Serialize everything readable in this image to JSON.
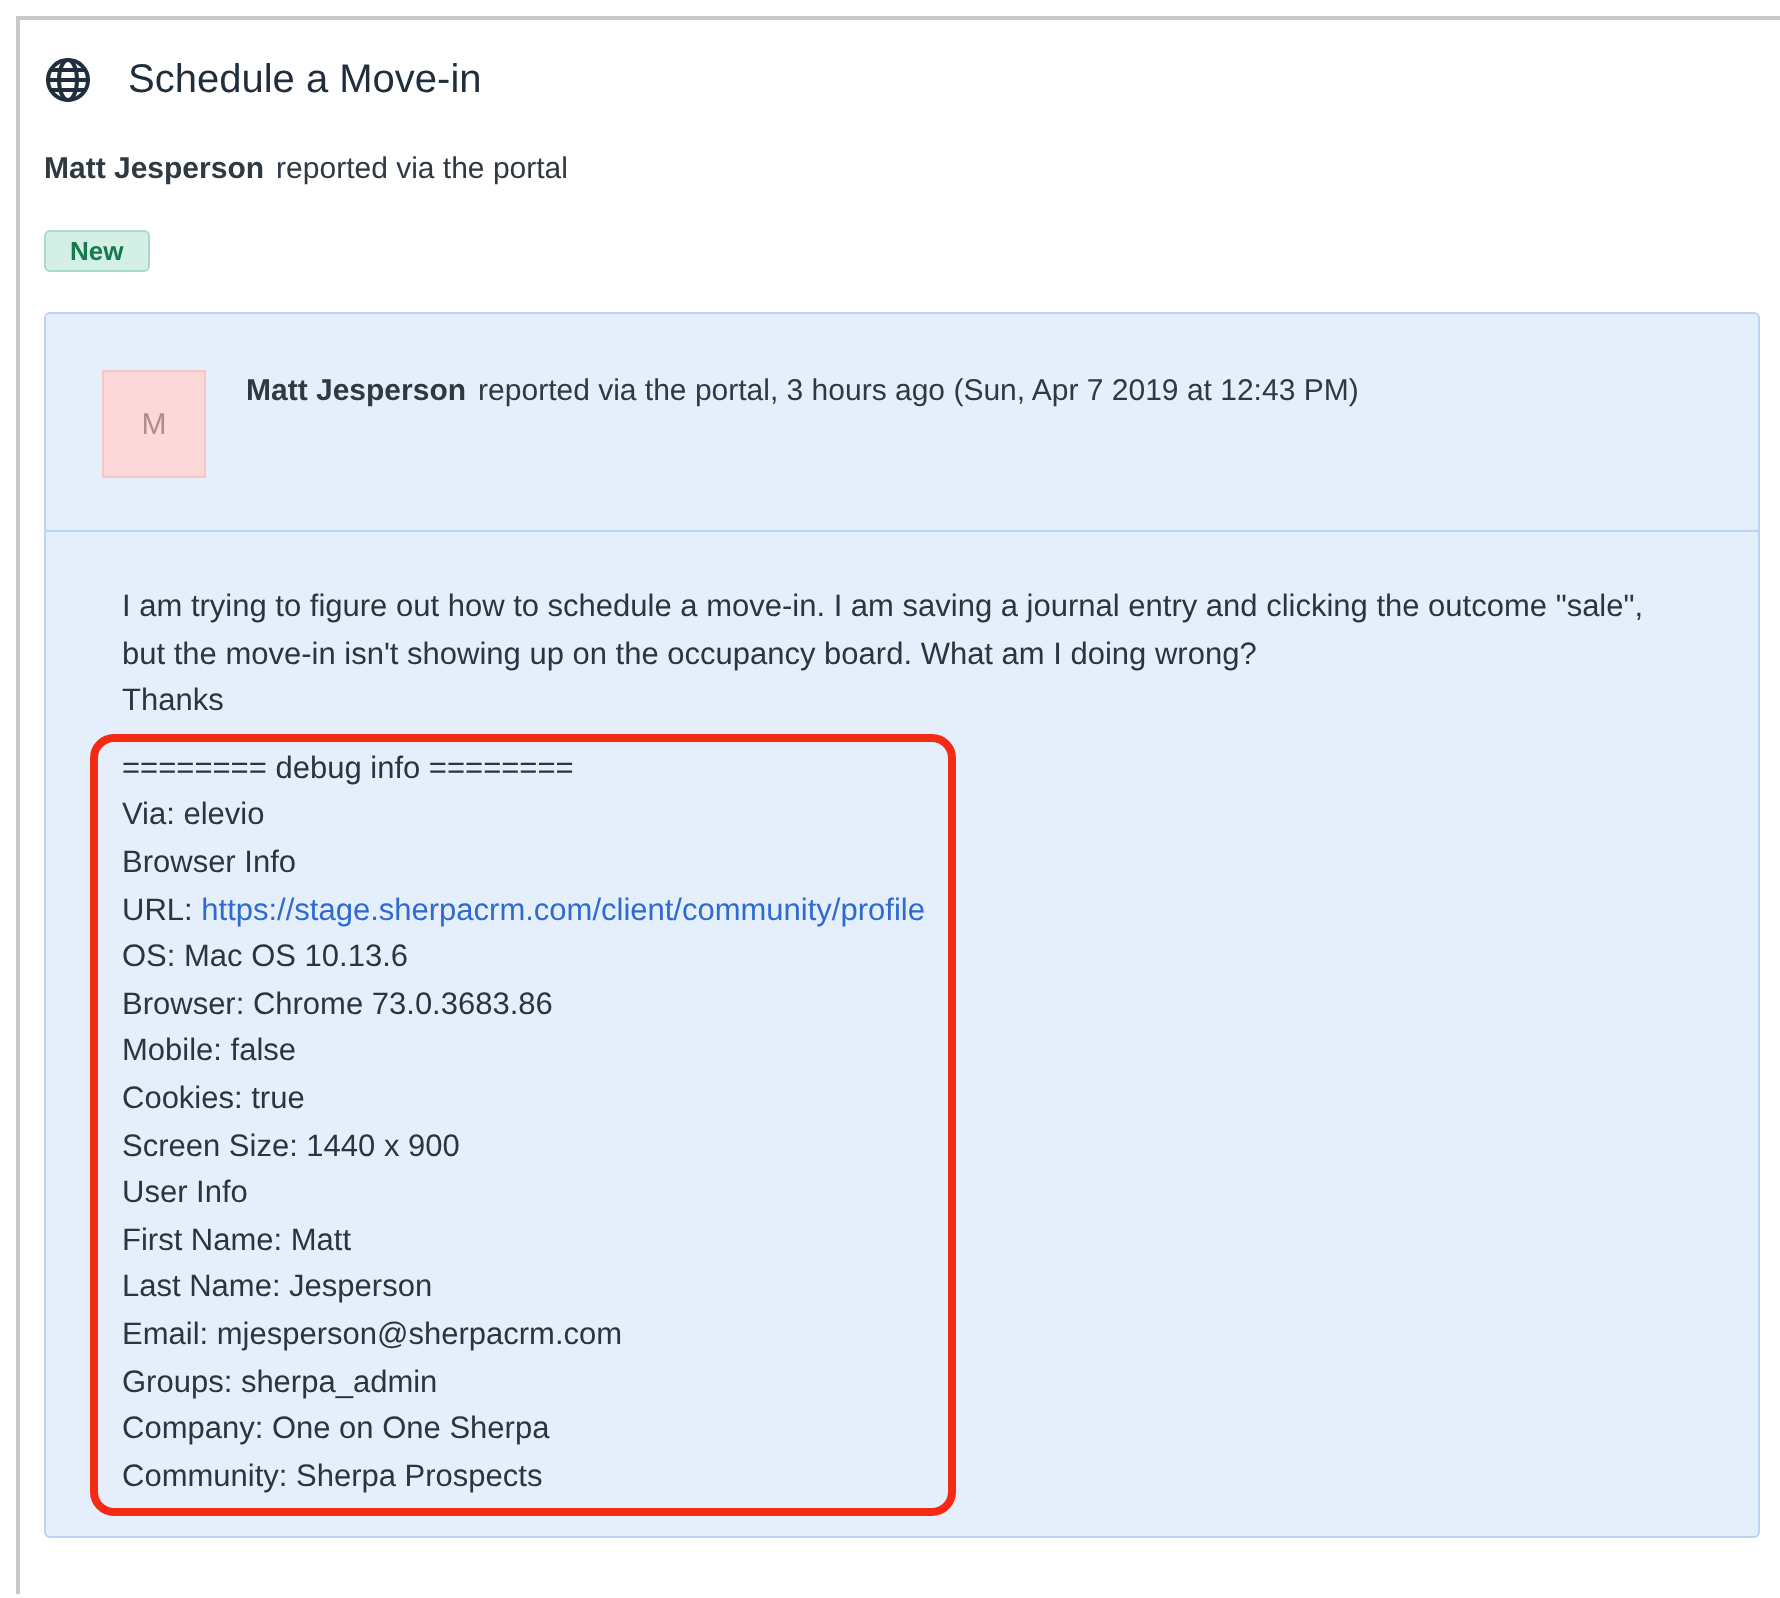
{
  "ticket": {
    "title": "Schedule a Move-in",
    "reporter": "Matt Jesperson",
    "channel": "reported via the portal",
    "status": "New"
  },
  "message": {
    "avatar": "M",
    "author": "Matt Jesperson",
    "meta": "reported via the portal, 3 hours ago (Sun, Apr 7 2019 at 12:43 PM)",
    "body": "I am trying to figure out how to schedule a move-in. I am saving a journal entry and clicking the outcome \"sale\", but the move-in isn't showing up on the occupancy board. What am I doing wrong?",
    "closing": "Thanks",
    "debug": {
      "highlighted": true,
      "lines": [
        {
          "kind": "text",
          "text": "======== debug info ========"
        },
        {
          "kind": "text",
          "text": "Via: elevio"
        },
        {
          "kind": "text",
          "text": "Browser Info"
        },
        {
          "kind": "link",
          "text": "URL:",
          "link": "https://stage.sherpacrm.com/client/community/profile"
        },
        {
          "kind": "text",
          "text": "OS: Mac OS 10.13.6"
        },
        {
          "kind": "text",
          "text": "Browser: Chrome 73.0.3683.86"
        },
        {
          "kind": "text",
          "text": "Mobile: false"
        },
        {
          "kind": "text",
          "text": "Cookies: true"
        },
        {
          "kind": "text",
          "text": "Screen Size: 1440 x 900"
        },
        {
          "kind": "text",
          "text": "User Info"
        },
        {
          "kind": "text",
          "text": "First Name: Matt"
        },
        {
          "kind": "text",
          "text": "Last Name: Jesperson"
        },
        {
          "kind": "text",
          "text": "Email: mjesperson@sherpacrm.com"
        },
        {
          "kind": "text",
          "text": "Groups: sherpa_admin"
        },
        {
          "kind": "text",
          "text": "Company: One on One Sherpa"
        },
        {
          "kind": "text",
          "text": "Community: Sherpa Prospects"
        }
      ]
    }
  }
}
